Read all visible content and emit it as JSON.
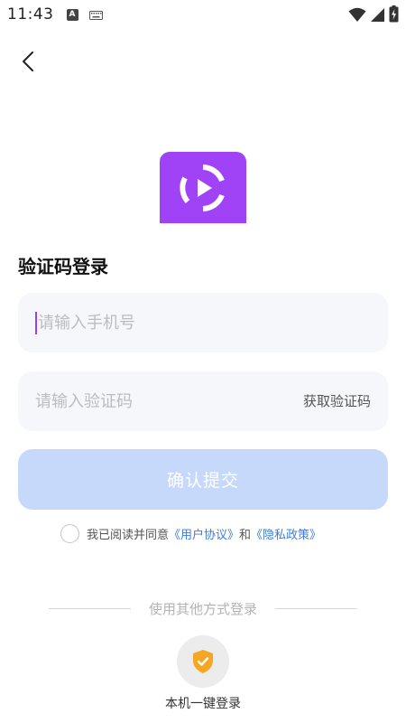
{
  "status_bar": {
    "time": "11:43",
    "a_badge": "A",
    "icons": [
      "keyboard-icon",
      "wifi-icon",
      "signal-icon",
      "battery-charging-icon"
    ]
  },
  "header": {
    "back_icon": "chevron-left-icon"
  },
  "logo": {
    "icon": "app-logo-play-icon",
    "color": "#a042f5"
  },
  "page": {
    "title": "验证码登录"
  },
  "form": {
    "phone": {
      "value": "",
      "placeholder": "请输入手机号"
    },
    "code": {
      "value": "",
      "placeholder": "请输入验证码"
    },
    "get_code_label": "获取验证码",
    "submit_label": "确认提交"
  },
  "agreement": {
    "prefix": "我已阅读并同意",
    "user_agreement": "《用户协议》",
    "and": "和",
    "privacy_policy": "《隐私政策》",
    "checked": false
  },
  "other_login": {
    "divider_text": "使用其他方式登录",
    "one_key_icon": "shield-check-icon",
    "one_key_label": "本机一键登录"
  },
  "colors": {
    "accent": "#a042f5",
    "submit_disabled": "#c6d9fb",
    "link": "#3f7bd8",
    "field_bg": "#f6f7fa",
    "shield": "#f5a623"
  }
}
